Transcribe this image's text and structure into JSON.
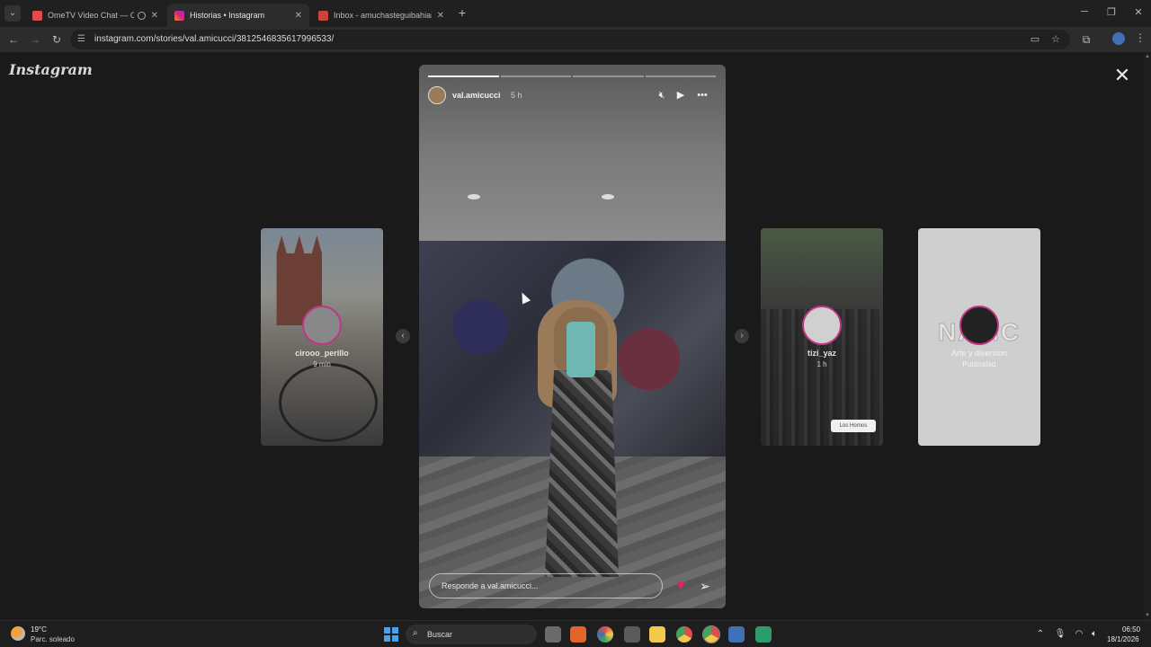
{
  "browser": {
    "tabs": [
      {
        "title": "OmeTV Video Chat — Ome",
        "favicon_color": "#e24b4b",
        "active": false
      },
      {
        "title": "Historias • Instagram",
        "favicon_color": "#d62976",
        "active": true
      },
      {
        "title": "Inbox - amuchasteguibahiano©",
        "favicon_color": "#c9453a",
        "active": false
      }
    ],
    "url": "instagram.com/stories/val.amicucci/3812546835617996533/"
  },
  "page": {
    "logo": "Instagram",
    "story": {
      "username": "val.amicucci",
      "time": "5 h",
      "progress": [
        1,
        0,
        0,
        0
      ],
      "reply_placeholder": "Responde a val.amicucci...",
      "icons": {
        "mute": "muted-speaker-icon",
        "play": "play-icon",
        "more": "more-options-icon",
        "like": "heart-icon",
        "send": "send-icon"
      }
    },
    "previews": [
      {
        "username": "cirooo_perillo",
        "time": "9 min"
      },
      {
        "username": "tizi_yaz",
        "time": "1 h",
        "badge": "Los Hornos"
      },
      {
        "username": "Arte y diversion",
        "time": "Publicidad",
        "brand_text": "NAMC"
      }
    ]
  },
  "taskbar": {
    "weather_temp": "19°C",
    "weather_desc": "Parc. soleado",
    "search_label": "Buscar",
    "time": "06:50",
    "date": "18/1/2026"
  }
}
